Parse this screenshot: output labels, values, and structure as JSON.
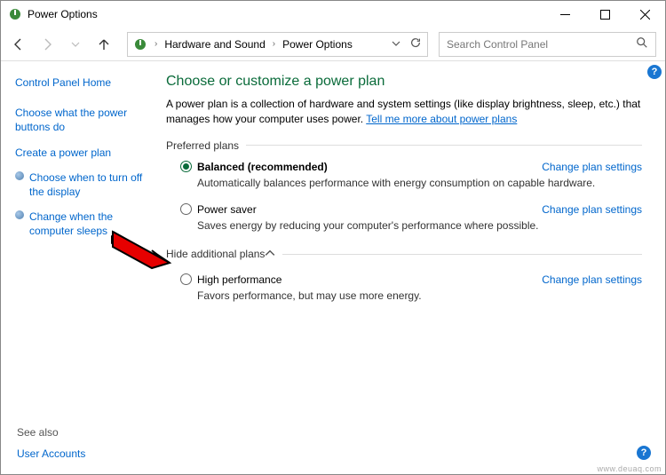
{
  "window": {
    "title": "Power Options"
  },
  "breadcrumb": {
    "item1": "Hardware and Sound",
    "item2": "Power Options"
  },
  "search": {
    "placeholder": "Search Control Panel"
  },
  "sidebar": {
    "home": "Control Panel Home",
    "items": [
      {
        "label": "Choose what the power buttons do"
      },
      {
        "label": "Create a power plan"
      },
      {
        "label": "Choose when to turn off the display"
      },
      {
        "label": "Change when the computer sleeps"
      }
    ]
  },
  "main": {
    "heading": "Choose or customize a power plan",
    "intro": "A power plan is a collection of hardware and system settings (like display brightness, sleep, etc.) that manages how your computer uses power. ",
    "intro_link": "Tell me more about power plans",
    "section_preferred": "Preferred plans",
    "section_additional": "Hide additional plans",
    "plans": {
      "balanced": {
        "name": "Balanced (recommended)",
        "desc": "Automatically balances performance with energy consumption on capable hardware.",
        "link": "Change plan settings"
      },
      "powersaver": {
        "name": "Power saver",
        "desc": "Saves energy by reducing your computer's performance where possible.",
        "link": "Change plan settings"
      },
      "highperf": {
        "name": "High performance",
        "desc": "Favors performance, but may use more energy.",
        "link": "Change plan settings"
      }
    }
  },
  "bottom": {
    "see_also": "See also",
    "user_accounts": "User Accounts"
  },
  "watermark": "www.deuaq.com"
}
